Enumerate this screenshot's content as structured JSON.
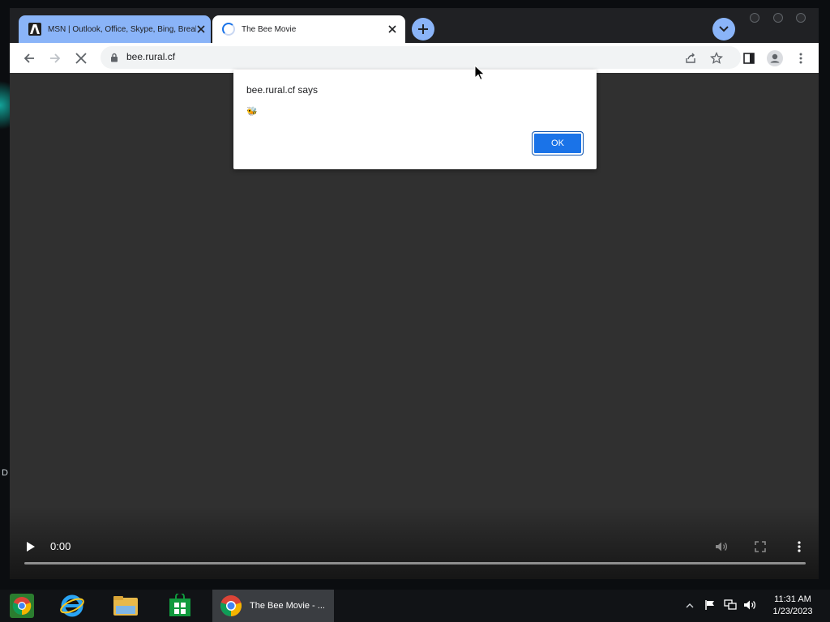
{
  "browser": {
    "tabs": [
      {
        "title": "MSN | Outlook, Office, Skype, Bing, Breaking News, and Latest Videos",
        "active": false,
        "icon": "msn-icon"
      },
      {
        "title": "The Bee Movie",
        "active": true,
        "icon": "loading-spinner-icon"
      }
    ],
    "url": "bee.rural.cf"
  },
  "dialog": {
    "title": "bee.rural.cf says",
    "message": "🐝",
    "ok_label": "OK"
  },
  "video": {
    "time": "0:00",
    "progress": 0
  },
  "taskbar": {
    "active_task_label": "The Bee Movie - ...",
    "time": "11:31 AM",
    "date": "1/23/2023"
  },
  "desktop": {
    "edge_letter": "D"
  },
  "colors": {
    "accent": "#1a73e8",
    "tab_inactive": "#8ab4f8",
    "content_bg": "#303030"
  }
}
